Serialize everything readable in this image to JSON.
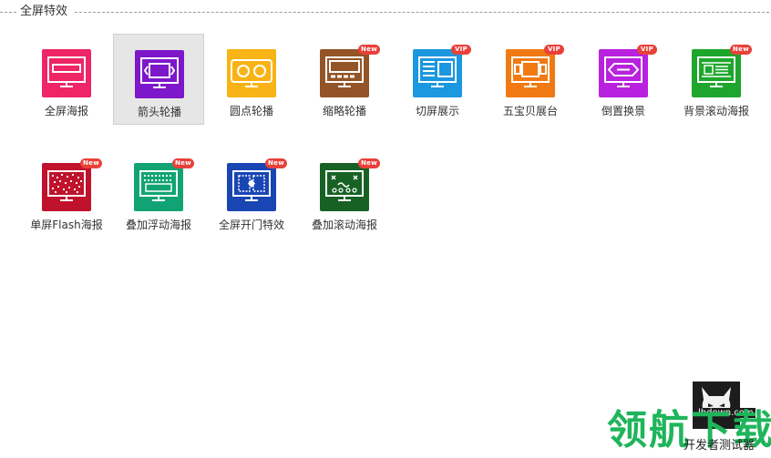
{
  "section": {
    "title": "全屏特效"
  },
  "effects": [
    {
      "label": "全屏海报",
      "color": "#ee2566",
      "badge": "",
      "icon": "fullscreen-poster-icon",
      "selected": false
    },
    {
      "label": "箭头轮播",
      "color": "#7d17c9",
      "badge": "",
      "icon": "arrow-carousel-icon",
      "selected": true
    },
    {
      "label": "圆点轮播",
      "color": "#f8b316",
      "badge": "",
      "icon": "dot-carousel-icon",
      "selected": false
    },
    {
      "label": "缩略轮播",
      "color": "#935427",
      "badge": "New",
      "icon": "thumbnail-carousel-icon",
      "selected": false
    },
    {
      "label": "切屏展示",
      "color": "#1c98e0",
      "badge": "VIP",
      "icon": "screen-switch-icon",
      "selected": false
    },
    {
      "label": "五宝贝展台",
      "color": "#f17a12",
      "badge": "VIP",
      "icon": "product-showcase-icon",
      "selected": false
    },
    {
      "label": "倒置换景",
      "color": "#b821dd",
      "badge": "VIP",
      "icon": "inverted-scene-icon",
      "selected": false
    },
    {
      "label": "背景滚动海报",
      "color": "#1ea62c",
      "badge": "New",
      "icon": "background-scroll-poster-icon",
      "selected": false
    },
    {
      "label": "单屏Flash海报",
      "color": "#c0122c",
      "badge": "New",
      "icon": "flash-poster-icon",
      "selected": false
    },
    {
      "label": "叠加浮动海报",
      "color": "#12a374",
      "badge": "New",
      "icon": "overlay-float-poster-icon",
      "selected": false
    },
    {
      "label": "全屏开门特效",
      "color": "#1a46b4",
      "badge": "New",
      "icon": "door-open-effect-icon",
      "selected": false
    },
    {
      "label": "叠加滚动海报",
      "color": "#176124",
      "badge": "New",
      "icon": "overlay-scroll-poster-icon",
      "selected": false
    }
  ],
  "watermark": {
    "site": "lhdown.com",
    "brand": "领航下载",
    "sub": "开发者测试器"
  }
}
